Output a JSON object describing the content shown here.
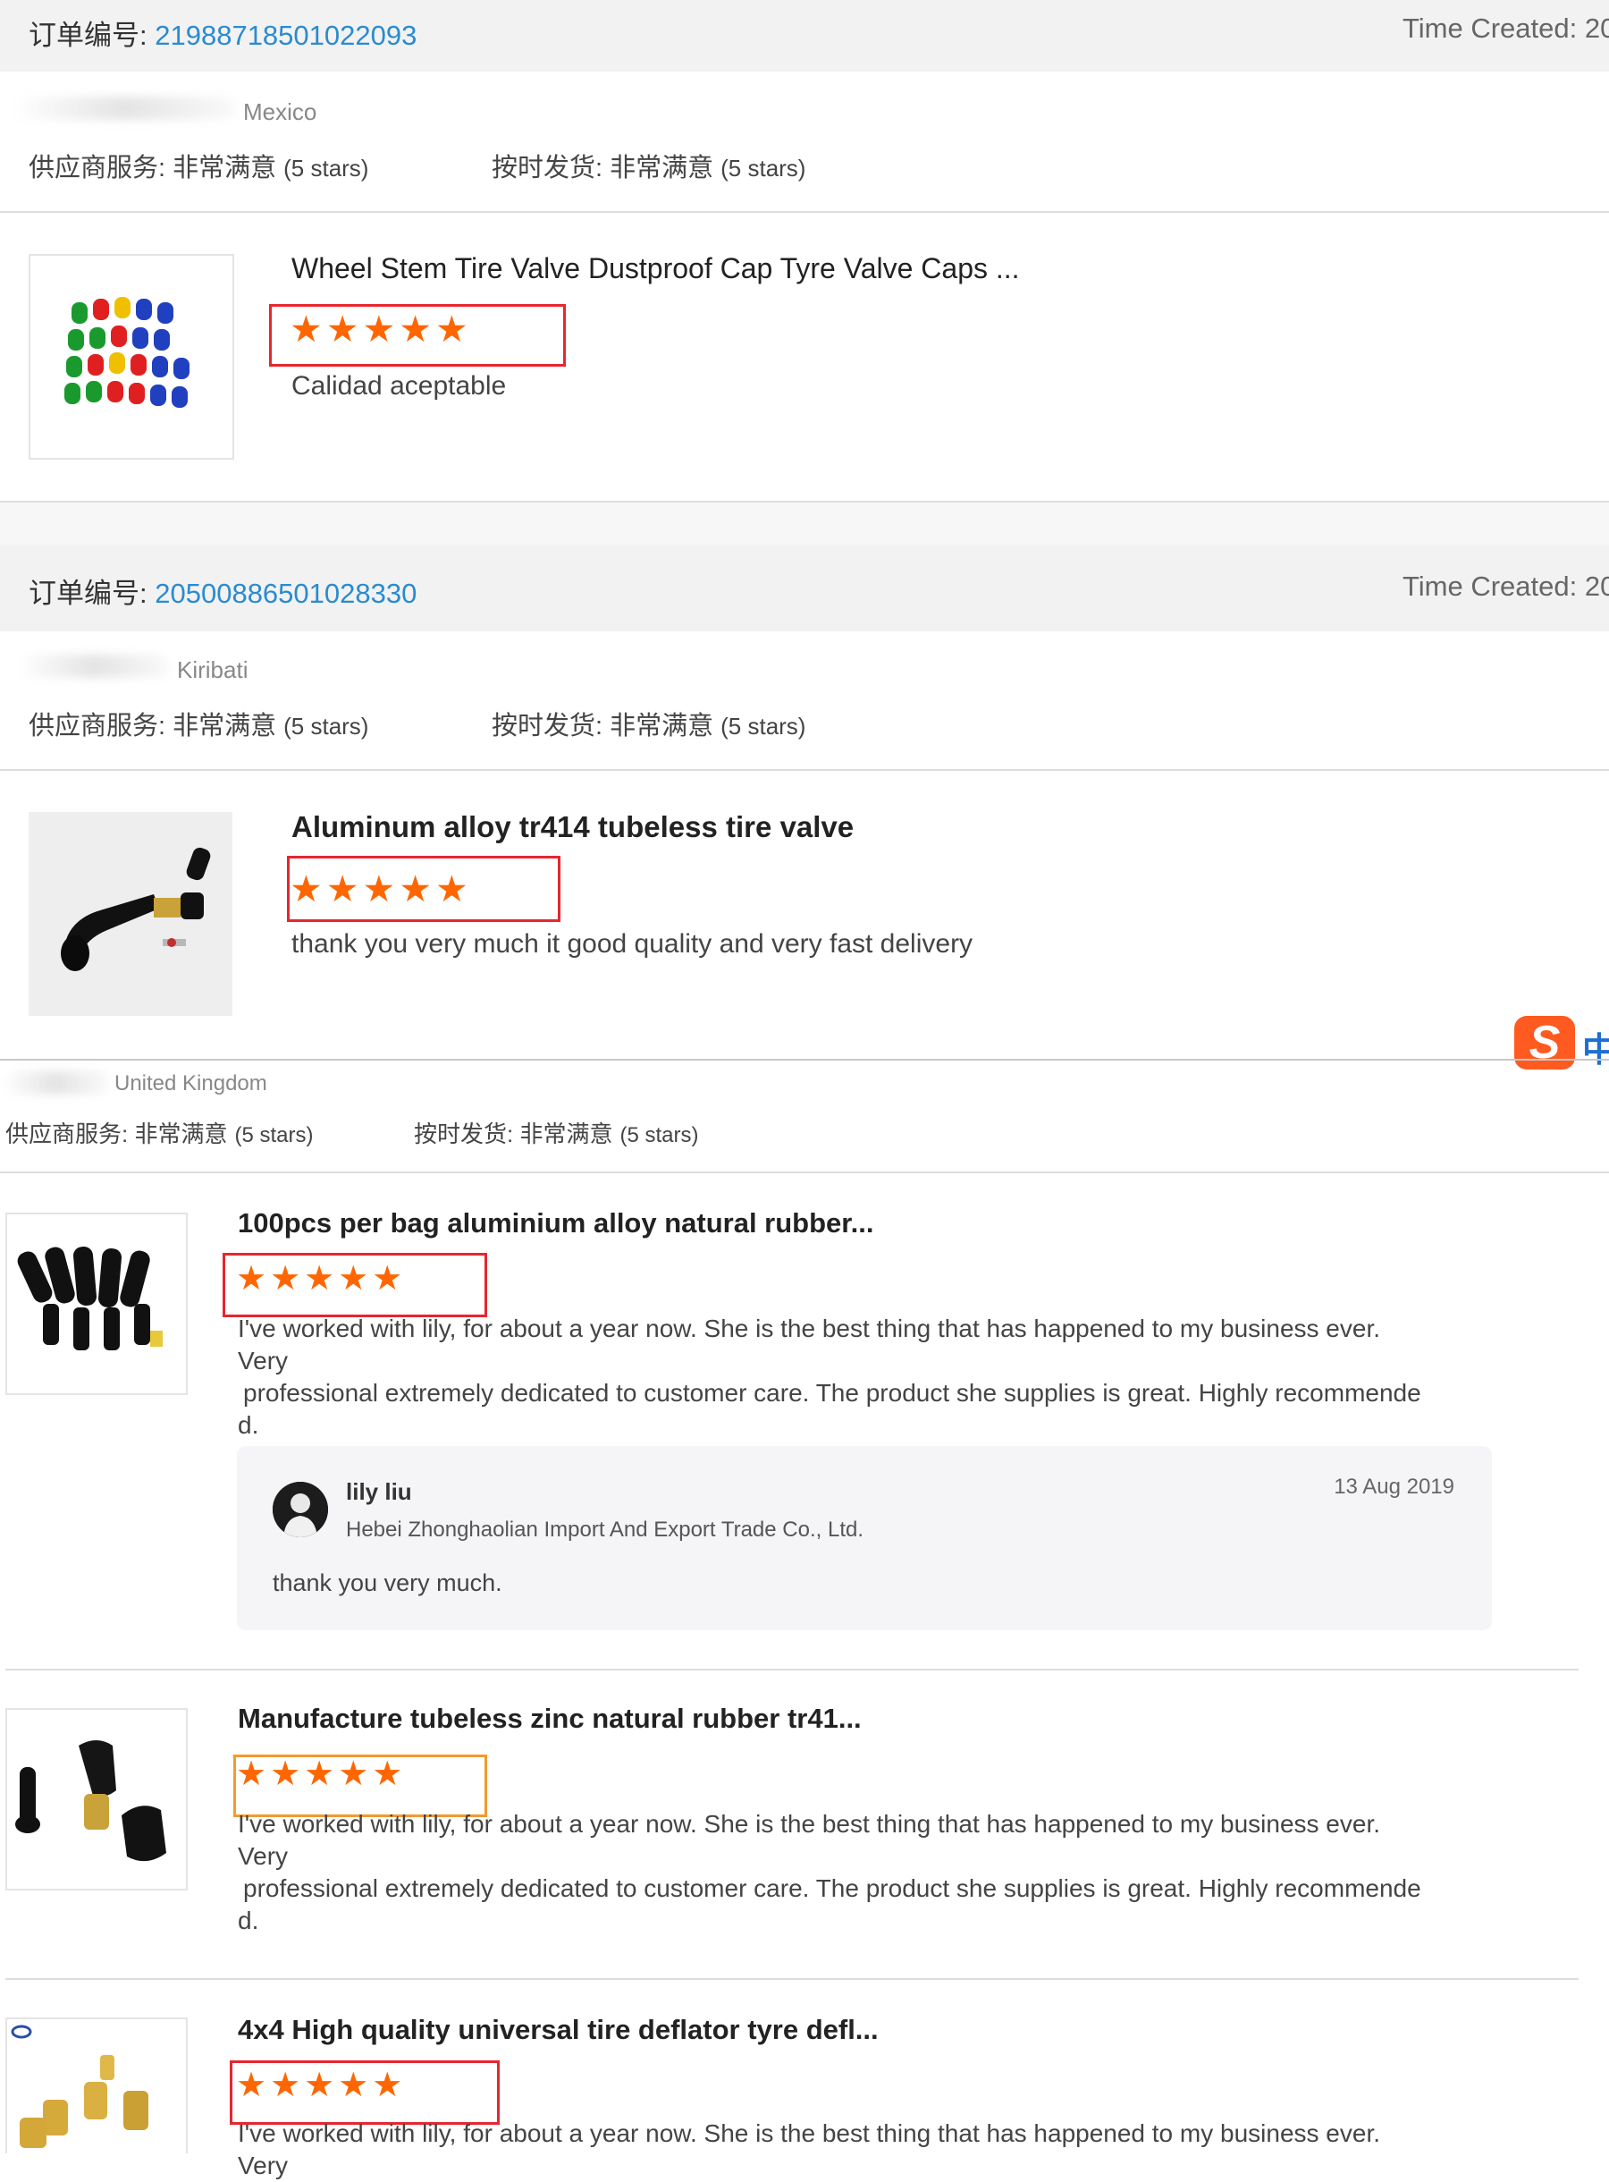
{
  "orders": [
    {
      "label": "订单编号:",
      "number": "21988718501022093",
      "time_created": "Time Created: 20",
      "country": "Mexico",
      "supplier_service": "供应商服务: 非常满意",
      "supplier_stars": "(5 stars)",
      "ontime_delivery": "按时发货: 非常满意",
      "ontime_stars": "(5 stars)",
      "product": {
        "title": "Wheel Stem Tire Valve Dustproof Cap Tyre Valve Caps ...",
        "rating": 5,
        "stars": "★★★★★",
        "review": "Calidad aceptable"
      }
    },
    {
      "label": "订单编号:",
      "number": "20500886501028330",
      "time_created": "Time Created: 20",
      "country": "Kiribati",
      "supplier_service": "供应商服务: 非常满意",
      "supplier_stars": "(5 stars)",
      "ontime_delivery": "按时发货: 非常满意",
      "ontime_stars": "(5 stars)",
      "product": {
        "title": "Aluminum alloy tr414 tubeless tire valve",
        "rating": 5,
        "stars": "★★★★★",
        "review": "thank you very much it good quality and very fast delivery"
      }
    },
    {
      "country": "United Kingdom",
      "supplier_service": "供应商服务: 非常满意",
      "supplier_stars": "(5 stars)",
      "ontime_delivery": "按时发货: 非常满意",
      "ontime_stars": "(5 stars)",
      "products": [
        {
          "title": "100pcs per bag aluminium alloy natural rubber...",
          "rating": 5,
          "stars": "★★★★★",
          "review_line1": "I've worked with lily, for about a year now. She is the best thing that has happened to my business ever. Very",
          "review_line2": "professional extremely dedicated to customer care. The product she supplies is great. Highly recommende",
          "review_line3": "d.",
          "reply": {
            "name": "lily liu",
            "company": "Hebei Zhonghaolian Import And Export Trade Co., Ltd.",
            "date": "13 Aug 2019",
            "text": "thank you very much."
          }
        },
        {
          "title": "Manufacture tubeless zinc natural rubber tr41...",
          "rating": 5,
          "stars": "★★★★★",
          "review_line1": "I've worked with lily, for about a year now. She is the best thing that has happened to my business ever. Very",
          "review_line2": "professional extremely dedicated to customer care. The product she supplies is great. Highly recommende",
          "review_line3": "d."
        },
        {
          "title": "4x4 High quality universal tire deflator tyre defl...",
          "rating": 5,
          "stars": "★★★★★",
          "review_line1": "I've worked with lily, for about a year now. She is the best thing that has happened to my business ever. Very"
        }
      ]
    }
  ],
  "ime_badge": {
    "logo": "S",
    "lang": "中"
  },
  "colors": {
    "star": "#ff6600",
    "highlight_box": "#e8262e",
    "highlight_box_alt": "#f39a2f",
    "order_number": "#2a8bd0"
  }
}
